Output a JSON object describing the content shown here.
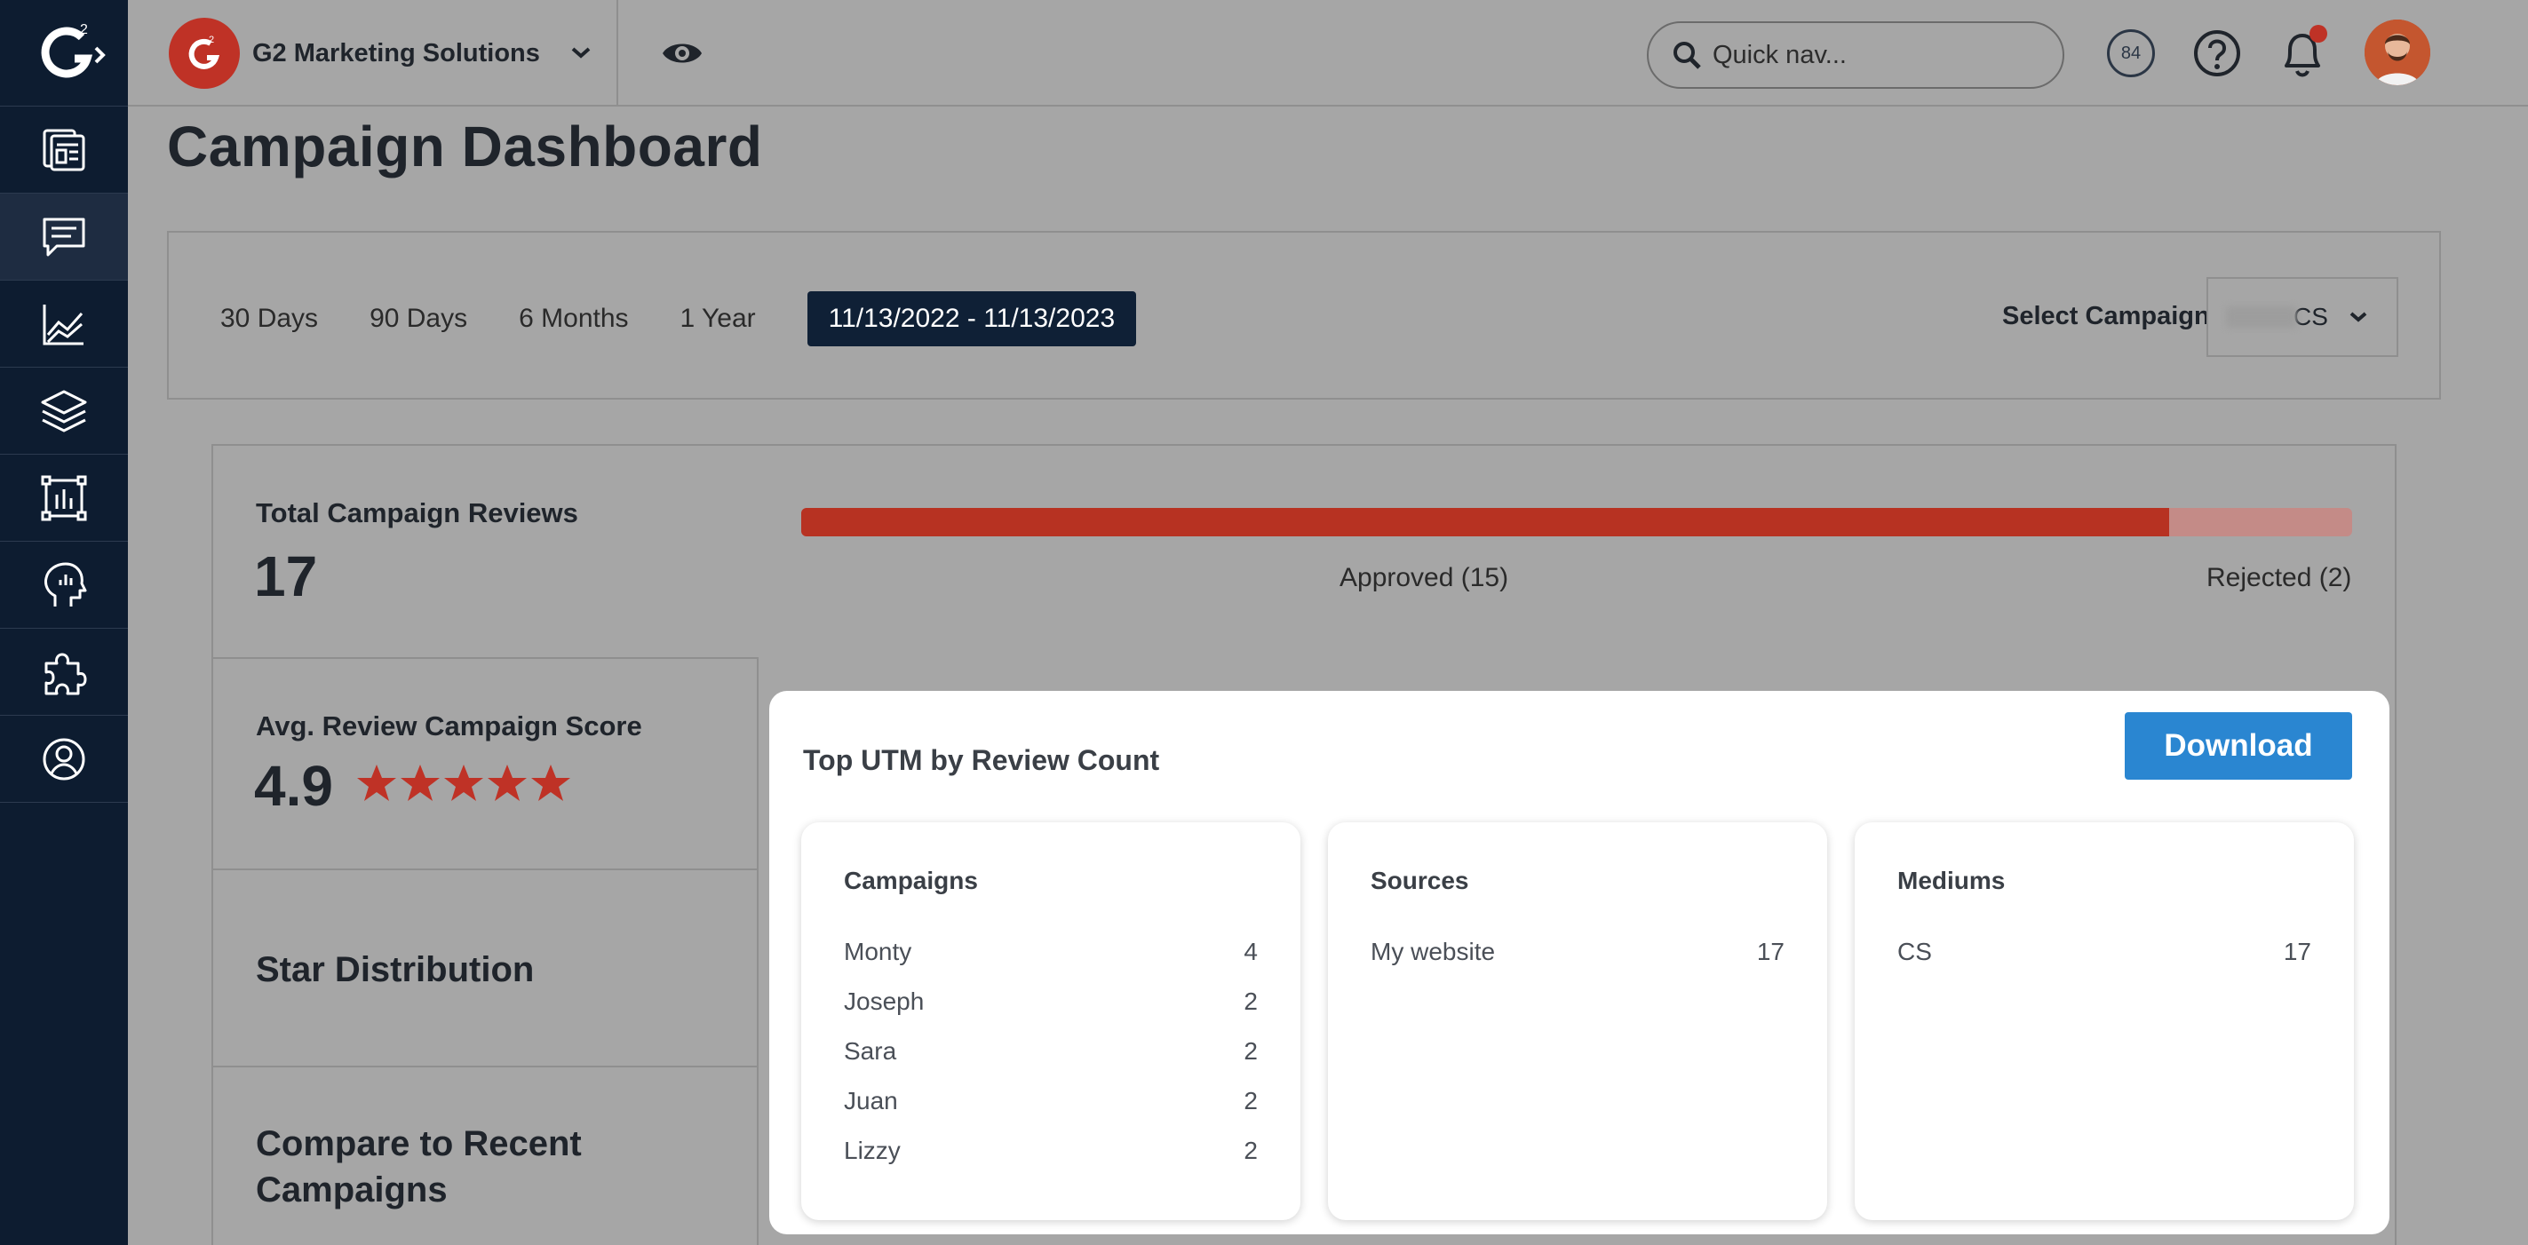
{
  "rail": {
    "items": [
      {
        "icon": "dashboard-icon"
      },
      {
        "icon": "reviews-chat-icon",
        "active": true
      },
      {
        "icon": "analytics-chart-icon"
      },
      {
        "icon": "layers-icon"
      },
      {
        "icon": "buyer-intent-icon"
      },
      {
        "icon": "insights-head-icon"
      },
      {
        "icon": "integrations-puzzle-icon"
      },
      {
        "icon": "profile-icon"
      }
    ]
  },
  "header": {
    "org_name": "G2 Marketing Solutions",
    "search_placeholder": "Quick nav...",
    "badge_count": "84"
  },
  "page": {
    "title": "Campaign Dashboard"
  },
  "filters": {
    "ranges": [
      "30 Days",
      "90 Days",
      "6 Months",
      "1 Year"
    ],
    "active_range": "11/13/2022 - 11/13/2023",
    "select_label": "Select Campaign",
    "select_value": "CS"
  },
  "stats": {
    "total_label": "Total Campaign Reviews",
    "total_value": "17",
    "approved_label": "Approved (15)",
    "rejected_label": "Rejected (2)",
    "approved_fraction": 0.882,
    "score_label": "Avg. Review Campaign Score",
    "score_value": "4.9",
    "stars": 5,
    "star_distribution_label": "Star Distribution",
    "compare_label": "Compare to Recent Campaigns"
  },
  "modal": {
    "title": "Top UTM by Review Count",
    "download_label": "Download",
    "campaigns": {
      "heading": "Campaigns",
      "rows": [
        {
          "name": "Monty",
          "count": "4"
        },
        {
          "name": "Joseph",
          "count": "2"
        },
        {
          "name": "Sara",
          "count": "2"
        },
        {
          "name": "Juan",
          "count": "2"
        },
        {
          "name": "Lizzy",
          "count": "2"
        }
      ]
    },
    "sources": {
      "heading": "Sources",
      "rows": [
        {
          "name": "My website",
          "count": "17"
        }
      ]
    },
    "mediums": {
      "heading": "Mediums",
      "rows": [
        {
          "name": "CS",
          "count": "17"
        }
      ]
    }
  },
  "colors": {
    "rail": "#0d1c30",
    "brand_red": "#bf3226",
    "accent_blue": "#2a86d1",
    "active_range_bg": "#0f2036"
  }
}
